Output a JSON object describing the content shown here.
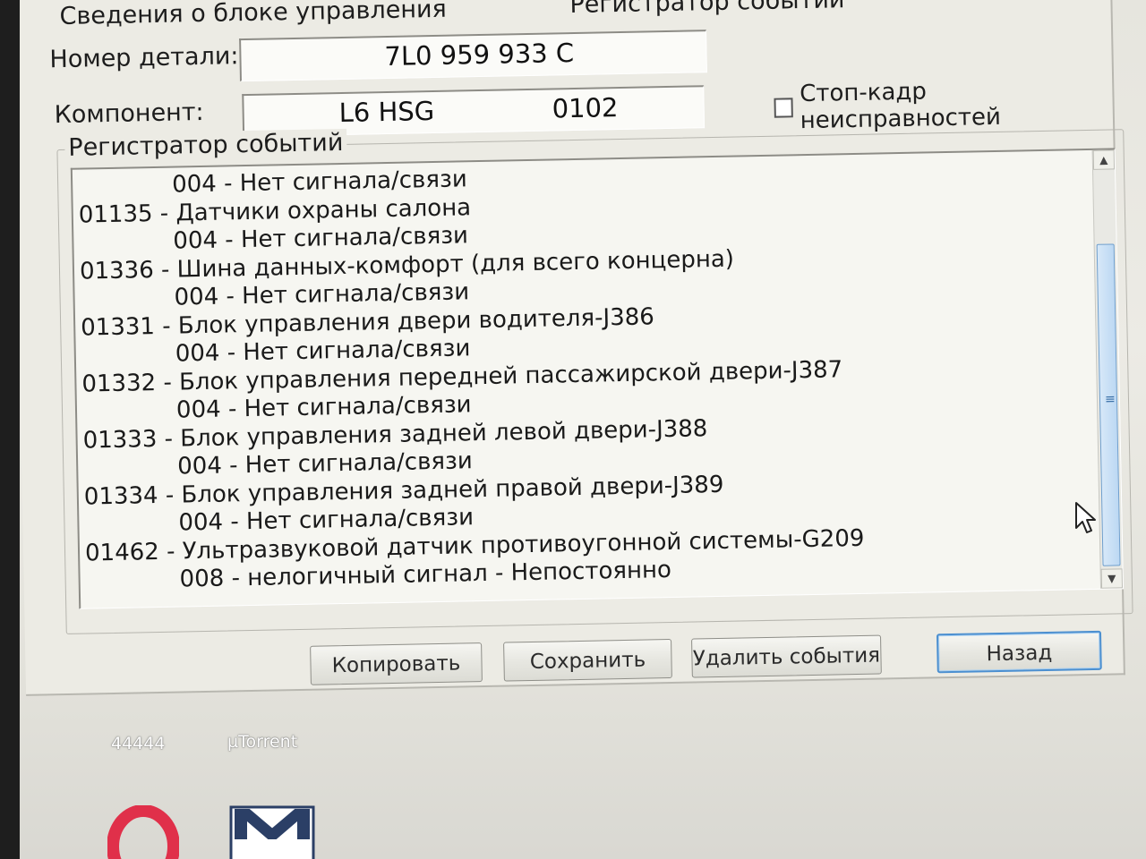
{
  "group_top": {
    "title": "Сведения о блоке управления",
    "title_right": "Регистратор событий"
  },
  "part_number": {
    "label": "Номер детали:",
    "value": "7L0 959 933 C"
  },
  "component": {
    "label": "Компонент:",
    "name": "L6 HSG",
    "code": "0102"
  },
  "freeze_frame": {
    "label": "Стоп-кадр неисправностей",
    "checked": false
  },
  "events": {
    "title": "Регистратор событий",
    "lines": [
      {
        "text": "004 - Нет сигнала/связи",
        "sub": true
      },
      {
        "text": "01135 - Датчики охраны салона",
        "sub": false
      },
      {
        "text": "004 - Нет сигнала/связи",
        "sub": true
      },
      {
        "text": "01336 - Шина данных-комфорт (для всего концерна)",
        "sub": false
      },
      {
        "text": "004 - Нет сигнала/связи",
        "sub": true
      },
      {
        "text": "01331 - Блок управления двери водителя-J386",
        "sub": false
      },
      {
        "text": "004 - Нет сигнала/связи",
        "sub": true
      },
      {
        "text": "01332 - Блок управления передней пассажирской двери-J387",
        "sub": false
      },
      {
        "text": "004 - Нет сигнала/связи",
        "sub": true
      },
      {
        "text": "01333 - Блок управления задней левой двери-J388",
        "sub": false
      },
      {
        "text": "004 - Нет сигнала/связи",
        "sub": true
      },
      {
        "text": "01334 - Блок управления задней правой двери-J389",
        "sub": false
      },
      {
        "text": "004 - Нет сигнала/связи",
        "sub": true
      },
      {
        "text": "01462 - Ультразвуковой датчик противоугонной системы-G209",
        "sub": false
      },
      {
        "text": "008 - нелогичный сигнал - Непостоянно",
        "sub": true
      }
    ]
  },
  "buttons": {
    "copy": "Копировать",
    "save": "Сохранить",
    "delete_events": "Удалить события",
    "back": "Назад"
  },
  "desktop": {
    "icon1_label": "44444",
    "icon2_label": "µTorrent"
  },
  "colors": {
    "scroll_thumb": "#bcd8f3",
    "default_button_border": "#4b8fd0",
    "opera_icon": "#e0304a"
  }
}
